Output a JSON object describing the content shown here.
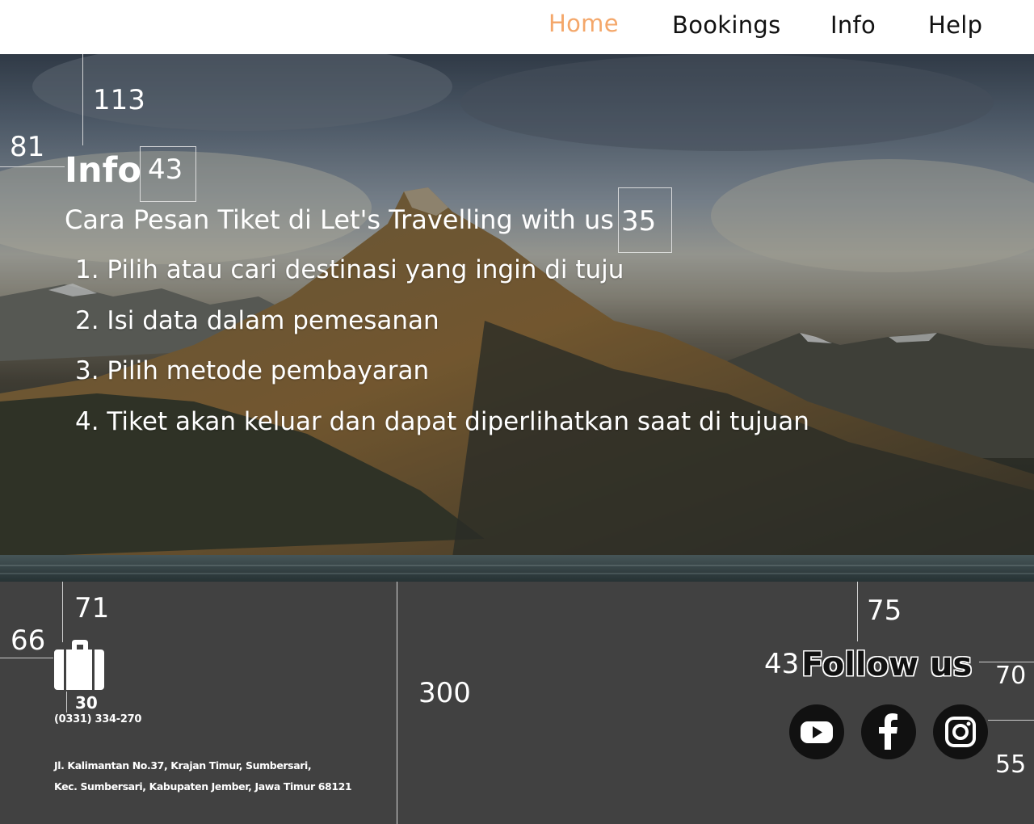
{
  "nav": {
    "items": [
      {
        "label": "Home",
        "active": true
      },
      {
        "label": "Bookings",
        "active": false
      },
      {
        "label": "Info",
        "active": false
      },
      {
        "label": "Help",
        "active": false
      }
    ],
    "active_color": "#f4a76a"
  },
  "hero": {
    "heading": "Info",
    "subtitle": "Cara Pesan Tiket di Let's Travelling with us",
    "steps": [
      "1. Pilih atau cari destinasi yang ingin di tuju",
      "2. Isi data dalam pemesanan",
      "3. Pilih metode pembayaran",
      "4. Tiket akan keluar dan dapat diperlihatkan saat di tujuan"
    ],
    "background_image": "mountain-lake-photo"
  },
  "annotations": {
    "hero_top": "113",
    "hero_left": "81",
    "heading_size": "43",
    "subtitle_size": "35",
    "footer_top": "71",
    "footer_left": "66",
    "icon_size": "30",
    "footer_height": "300",
    "follow_top": "75",
    "follow_size": "43",
    "follow_right": "70",
    "social_right": "55"
  },
  "footer": {
    "logo_icon": "suitcase-icon",
    "phone": "(0331) 334-270",
    "address_line1": "Jl. Kalimantan No.37, Krajan Timur, Sumbersari,",
    "address_line2": "Kec. Sumbersari, Kabupaten Jember, Jawa Timur 68121",
    "follow_label": "Follow us",
    "social": [
      "youtube-icon",
      "facebook-icon",
      "instagram-icon"
    ],
    "background_color": "#414141"
  }
}
